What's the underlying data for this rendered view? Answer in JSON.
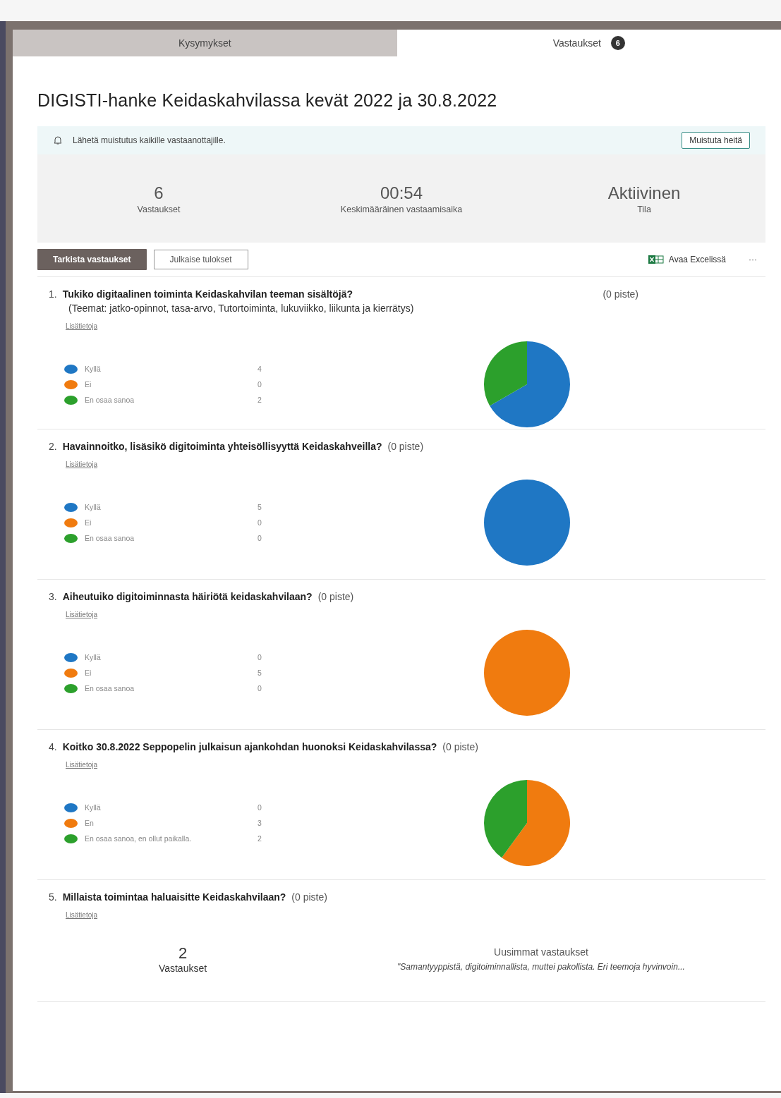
{
  "tabs": [
    {
      "label": "Kysymykset",
      "selected": false
    },
    {
      "label": "Vastaukset",
      "selected": true,
      "badge": "6"
    }
  ],
  "title": "DIGISTI-hanke Keidaskahvilassa kevät 2022 ja 30.8.2022",
  "reminder": {
    "text": "Lähetä muistutus kaikille vastaanottajille.",
    "button": "Muistuta heitä"
  },
  "stats": [
    {
      "value": "6",
      "label": "Vastaukset"
    },
    {
      "value": "00:54",
      "label": "Keskimääräinen vastaamisaika"
    },
    {
      "value": "Aktiivinen",
      "label": "Tila"
    }
  ],
  "toolbar": {
    "review": "Tarkista vastaukset",
    "publish": "Julkaise tulokset",
    "excel": "Avaa Excelissä",
    "more": "···"
  },
  "questions": [
    {
      "kind": "choice",
      "number": "1.",
      "text": "Tukiko digitaalinen toiminta Keidaskahvilan teeman sisältöjä?",
      "points": "(0 piste)",
      "subtitle": "(Teemat: jatko-opinnot, tasa-arvo, Tutortoiminta, lukuviikko, liikunta ja kierrätys)",
      "link": "Lisätietoja",
      "legend": [
        {
          "color": "#1f77c4"
        },
        {
          "color": "#f07b0f"
        },
        {
          "color": "#2ca02c"
        }
      ],
      "chart_data": {
        "type": "pie",
        "categories": [
          "Kyllä",
          "Ei",
          "En osaa sanoa"
        ],
        "values": [
          4,
          0,
          2
        ],
        "value_labels": [
          "4",
          "0",
          "2"
        ],
        "legend": "left"
      }
    },
    {
      "kind": "choice",
      "number": "2.",
      "text": "Havainnoitko, lisäsikö digitoiminta yhteisöllisyyttä Keidaskahveilla?",
      "points": "(0 piste)",
      "link": "Lisätietoja",
      "legend": [
        {
          "color": "#1f77c4"
        },
        {
          "color": "#f07b0f"
        },
        {
          "color": "#2ca02c"
        }
      ],
      "chart_data": {
        "type": "pie",
        "categories": [
          "Kyllä",
          "Ei",
          "En osaa sanoa"
        ],
        "values": [
          5,
          0,
          0
        ],
        "value_labels": [
          "5",
          "0",
          "0"
        ],
        "legend": "left"
      }
    },
    {
      "kind": "choice",
      "number": "3.",
      "text": "Aiheutuiko digitoiminnasta häiriötä keidaskahvilaan?",
      "points": "(0 piste)",
      "link": "Lisätietoja",
      "legend": [
        {
          "color": "#1f77c4"
        },
        {
          "color": "#f07b0f"
        },
        {
          "color": "#2ca02c"
        }
      ],
      "chart_data": {
        "type": "pie",
        "categories": [
          "Kyllä",
          "Ei",
          "En osaa sanoa"
        ],
        "values": [
          0,
          5,
          0
        ],
        "value_labels": [
          "0",
          "5",
          "0"
        ],
        "legend": "left"
      }
    },
    {
      "kind": "choice",
      "number": "4.",
      "text": "Koitko 30.8.2022 Seppopelin julkaisun ajankohdan huonoksi Keidaskahvilassa?",
      "points": "(0 piste)",
      "link": "Lisätietoja",
      "legend": [
        {
          "color": "#1f77c4"
        },
        {
          "color": "#f07b0f"
        },
        {
          "color": "#2ca02c"
        }
      ],
      "chart_data": {
        "type": "pie",
        "categories": [
          "Kyllä",
          "En",
          "En osaa sanoa, en ollut paikalla."
        ],
        "values": [
          0,
          3,
          2
        ],
        "value_labels": [
          "0",
          "3",
          "2"
        ],
        "legend": "left"
      }
    },
    {
      "kind": "text",
      "number": "5.",
      "text": "Millaista toimintaa haluaisitte Keidaskahvilaan?",
      "points": "(0 piste)",
      "link": "Lisätietoja",
      "count": "2",
      "count_label": "Vastaukset",
      "latest_title": "Uusimmat vastaukset",
      "latest": "\"Samantyyppistä, digitoiminnallista, muttei pakollista. Eri teemoja hyvinvoin..."
    }
  ]
}
